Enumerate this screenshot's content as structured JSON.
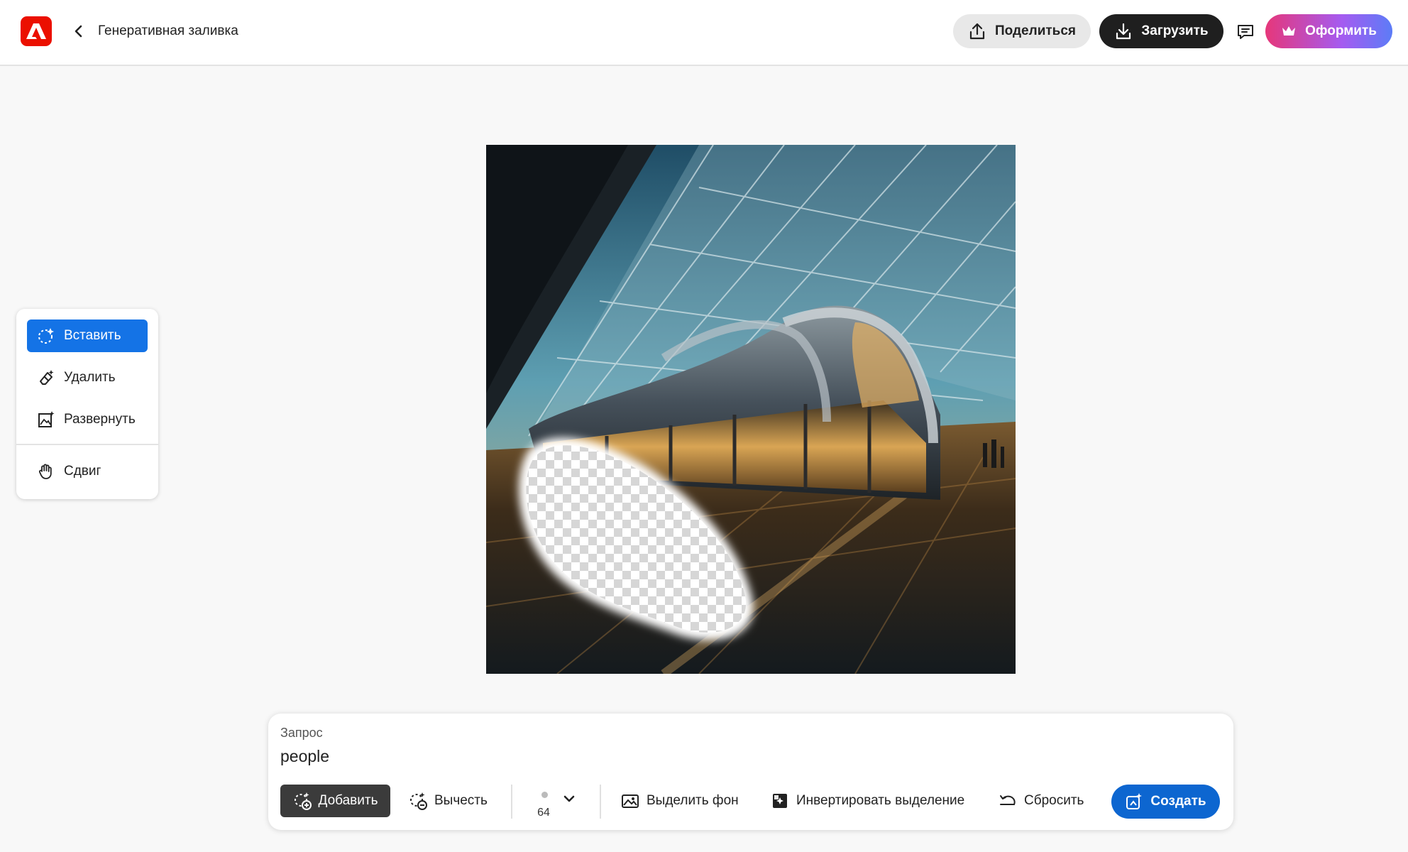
{
  "header": {
    "app_icon": "adobe-express-logo",
    "back_icon": "chevron-left-icon",
    "title": "Генеративная заливка",
    "share_label": "Поделиться",
    "download_label": "Загрузить",
    "comment_icon": "comment-icon",
    "subscribe_label": "Оформить"
  },
  "tools": {
    "items": [
      {
        "label": "Вставить",
        "icon": "insert-sparkle-icon",
        "active": true
      },
      {
        "label": "Удалить",
        "icon": "eraser-icon",
        "active": false
      },
      {
        "label": "Развернуть",
        "icon": "expand-icon",
        "active": false
      },
      {
        "label": "Сдвиг",
        "icon": "hand-icon",
        "active": false
      }
    ]
  },
  "prompt": {
    "label": "Запрос",
    "value": "people",
    "add_label": "Добавить",
    "subtract_label": "Вычесть",
    "brush_size": "64",
    "select_bg_label": "Выделить фон",
    "invert_label": "Инвертировать выделение",
    "reset_label": "Сбросить",
    "create_label": "Создать"
  },
  "colors": {
    "accent": "#1473e6",
    "create": "#0d66d0",
    "brand": "#eb1000"
  }
}
